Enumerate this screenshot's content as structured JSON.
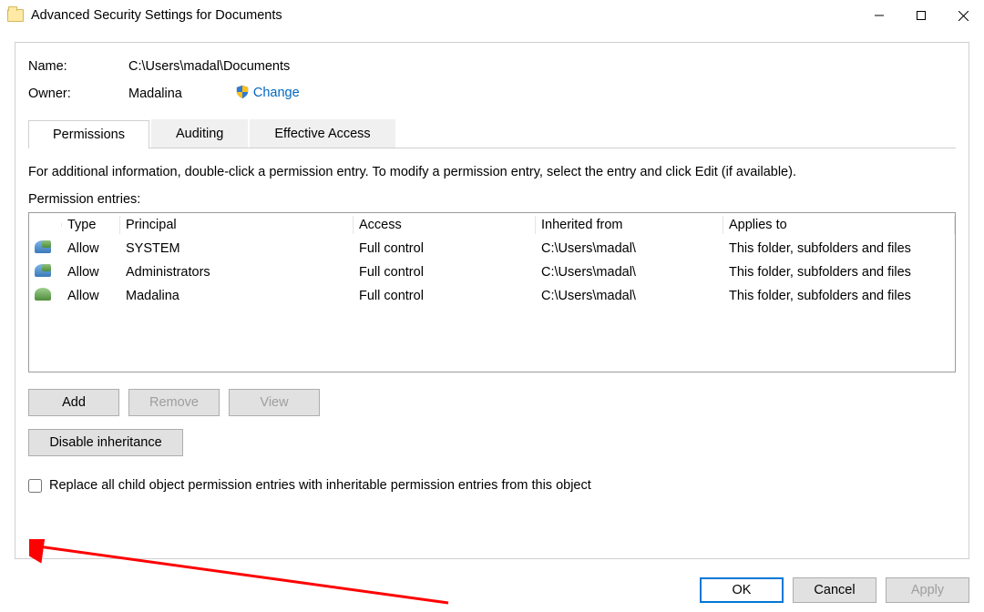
{
  "window": {
    "title": "Advanced Security Settings for Documents"
  },
  "header": {
    "name_label": "Name:",
    "name_value": "C:\\Users\\madal\\Documents",
    "owner_label": "Owner:",
    "owner_value": "Madalina",
    "change_label": "Change"
  },
  "tabs": {
    "permissions": "Permissions",
    "auditing": "Auditing",
    "effective": "Effective Access"
  },
  "hint": "For additional information, double-click a permission entry. To modify a permission entry, select the entry and click Edit (if available).",
  "entries_label": "Permission entries:",
  "columns": {
    "type": "Type",
    "principal": "Principal",
    "access": "Access",
    "inherited": "Inherited from",
    "applies": "Applies to"
  },
  "rows": [
    {
      "icon": "group",
      "type": "Allow",
      "principal": "SYSTEM",
      "access": "Full control",
      "inherited": "C:\\Users\\madal\\",
      "applies": "This folder, subfolders and files"
    },
    {
      "icon": "group",
      "type": "Allow",
      "principal": "Administrators",
      "access": "Full control",
      "inherited": "C:\\Users\\madal\\",
      "applies": "This folder, subfolders and files"
    },
    {
      "icon": "single",
      "type": "Allow",
      "principal": "Madalina",
      "access": "Full control",
      "inherited": "C:\\Users\\madal\\",
      "applies": "This folder, subfolders and files"
    }
  ],
  "buttons": {
    "add": "Add",
    "remove": "Remove",
    "view": "View",
    "disable_inh": "Disable inheritance",
    "replace_chk": "Replace all child object permission entries with inheritable permission entries from this object",
    "ok": "OK",
    "cancel": "Cancel",
    "apply": "Apply"
  }
}
